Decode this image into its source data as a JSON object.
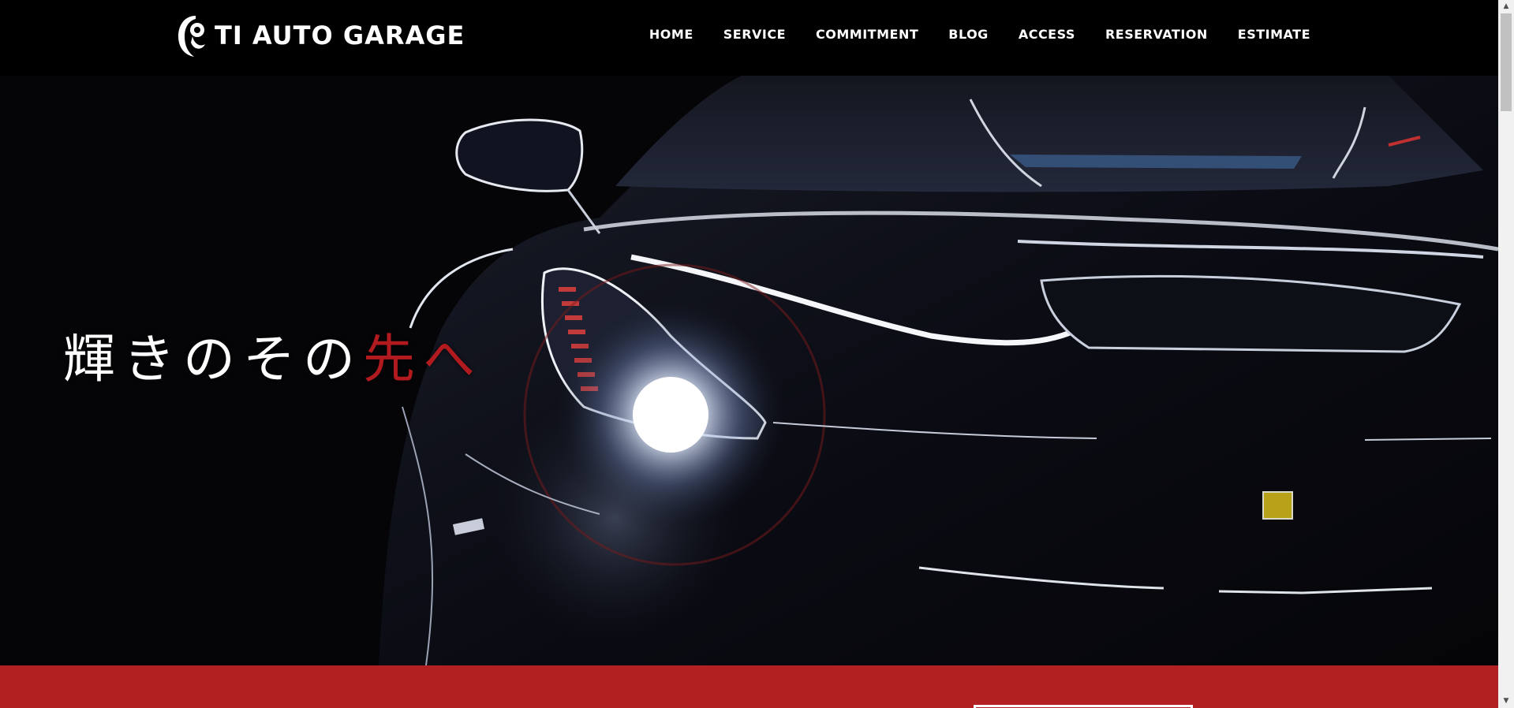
{
  "header": {
    "logo_text": "TI AUTO GARAGE",
    "nav": [
      {
        "label": "HOME"
      },
      {
        "label": "SERVICE"
      },
      {
        "label": "COMMITMENT"
      },
      {
        "label": "BLOG"
      },
      {
        "label": "ACCESS"
      },
      {
        "label": "RESERVATION"
      },
      {
        "label": "ESTIMATE"
      }
    ]
  },
  "hero": {
    "tagline_main": "輝きのその",
    "tagline_accent": "先へ"
  },
  "colors": {
    "header_bg": "#000000",
    "accent_red": "#b22022",
    "tagline_red": "#b11a1e",
    "text_white": "#ffffff"
  },
  "scrollbar": {
    "up_icon": "▲",
    "down_icon": "▼"
  }
}
